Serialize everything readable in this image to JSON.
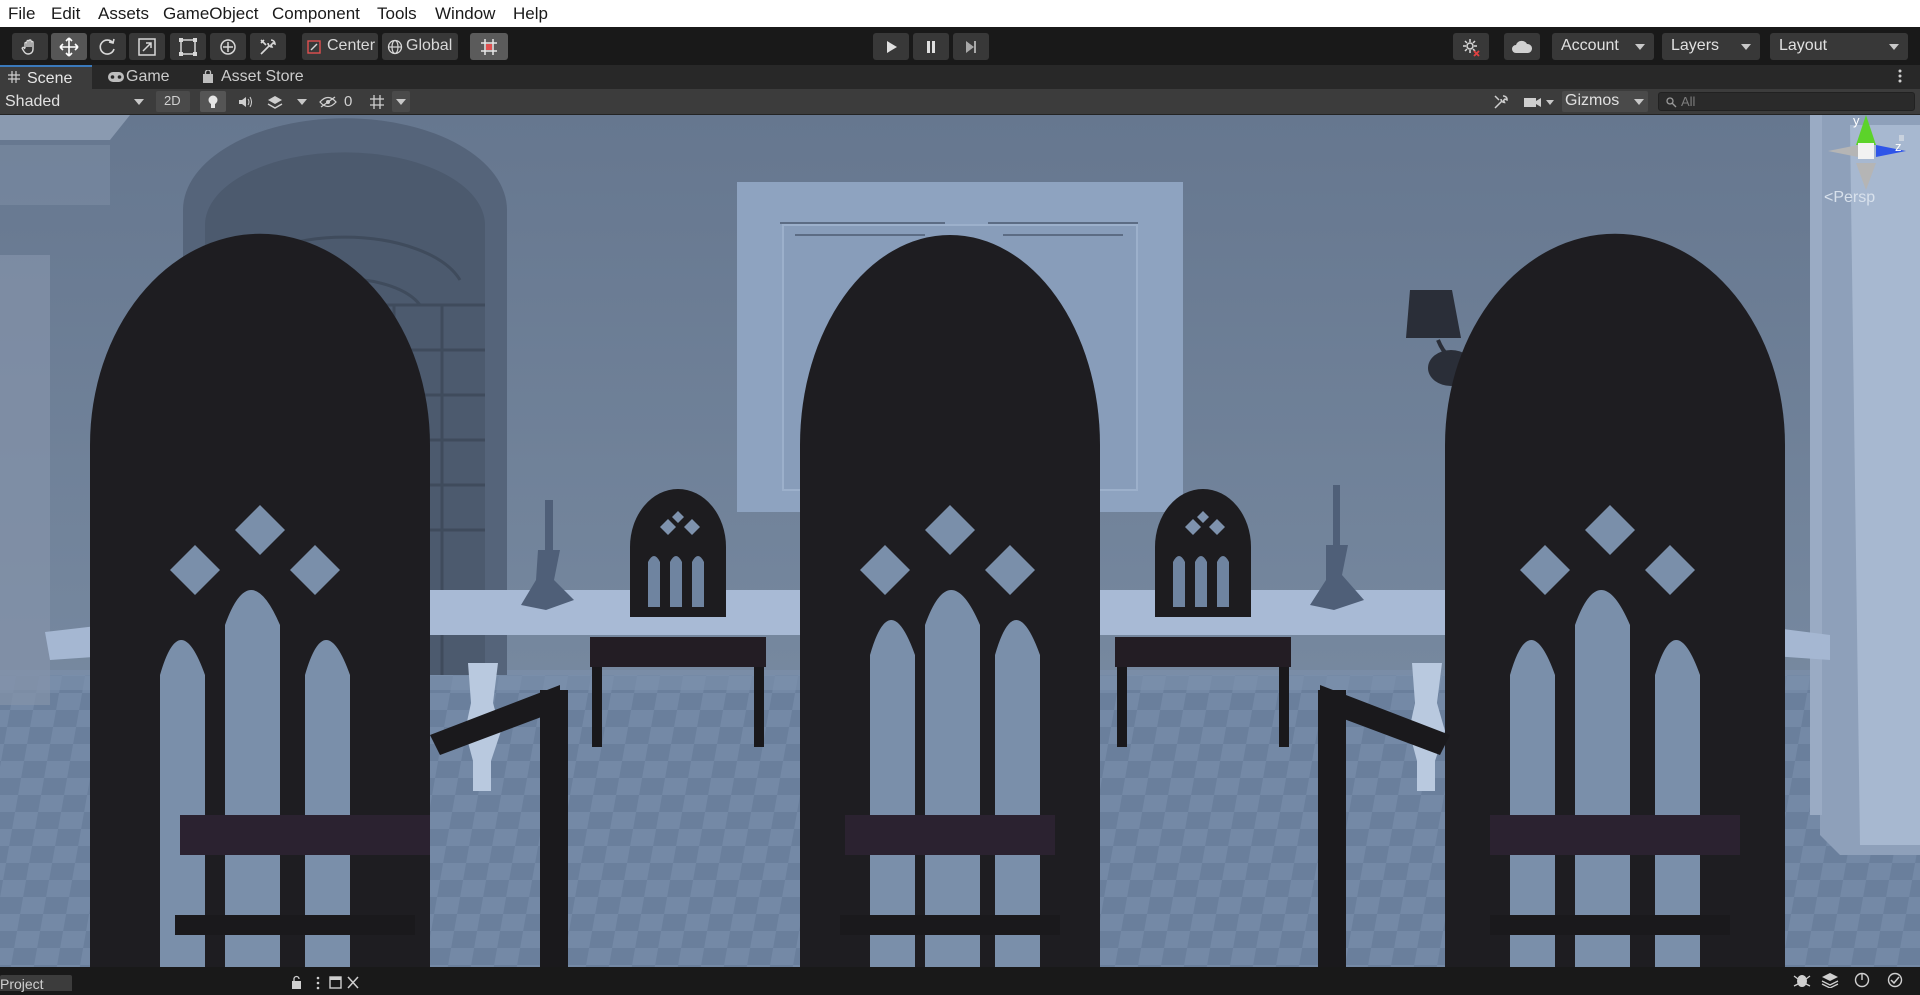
{
  "menu": [
    "File",
    "Edit",
    "Assets",
    "GameObject",
    "Component",
    "Tools",
    "Window",
    "Help"
  ],
  "toolbar": {
    "tools": [
      "hand-tool",
      "move-tool",
      "rotate-tool",
      "scale-tool",
      "rect-tool",
      "transform-tool",
      "custom-editor-tool"
    ],
    "active_tool": "move-tool",
    "pivot_label": "Center",
    "space_label": "Global",
    "play_controls": [
      "play",
      "pause",
      "step"
    ],
    "account_label": "Account",
    "layers_label": "Layers",
    "layout_label": "Layout"
  },
  "tabs": [
    {
      "label": "Scene",
      "icon": "grid-icon",
      "active": true
    },
    {
      "label": "Game",
      "icon": "gamepad-icon",
      "active": false
    },
    {
      "label": "Asset Store",
      "icon": "bag-icon",
      "active": false
    }
  ],
  "scene_toolbar": {
    "draw_mode": "Shaded",
    "toggle_2d": "2D",
    "hidden_count": "0",
    "gizmos_label": "Gizmos",
    "search_placeholder": "All"
  },
  "scene_gizmo": {
    "y_label": "y",
    "z_label": "z",
    "projection": "Persp"
  },
  "bottom": {
    "project_tab": "Project"
  },
  "colors": {
    "accent_blue": "#3a79bb",
    "axis_y": "#5cd32a",
    "axis_z": "#2f55e8",
    "viewport_bg": "#6b7f99"
  }
}
